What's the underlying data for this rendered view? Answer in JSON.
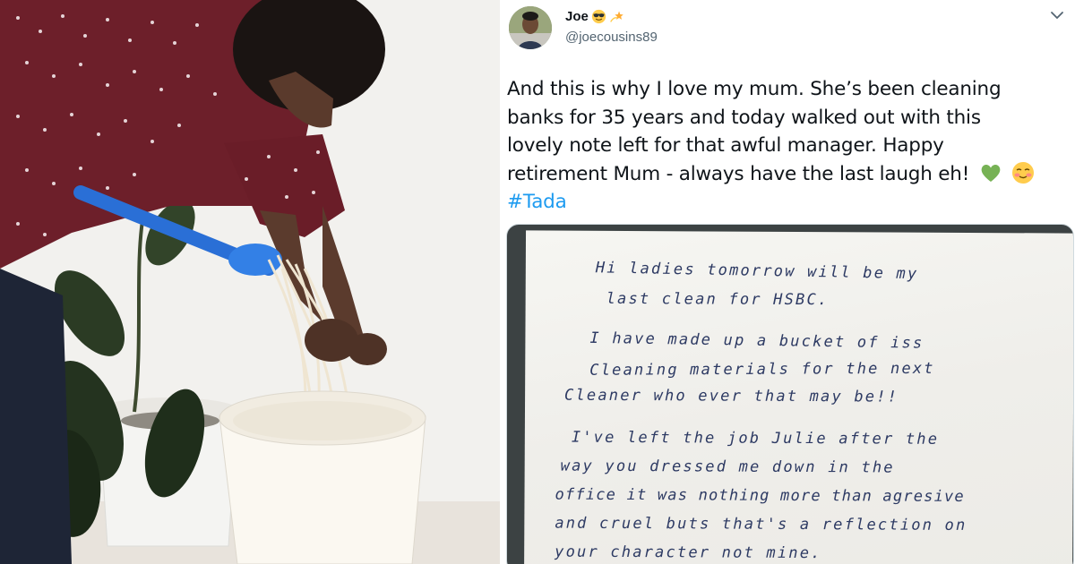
{
  "tweet": {
    "display_name": "Joe",
    "name_emojis": [
      "cool-face",
      "dizzy-star"
    ],
    "handle": "@joecousins89",
    "text_lines": [
      "And this is why I love my mum. She’s been cleaning",
      "banks for 35 years and today walked out with this",
      "lovely note left for that awful manager. Happy",
      "retirement Mum - always have the last laugh eh!"
    ],
    "trailing_emojis": [
      "green-heart",
      "blushing-face"
    ],
    "hashtag": "#Tada",
    "hashtag_color": "#1d9bf0"
  },
  "note": {
    "lines": [
      "Hi ladies tomorrow will be my",
      "last clean for HSBC.",
      "I have made up a bucket of iss",
      "Cleaning materials for the next",
      "Cleaner who ever that may be!!",
      "I've left the job Julie after the",
      "way you dressed me down in the",
      "office it was nothing more than agresive",
      "and cruel buts that's a reflection on",
      "your character not mine."
    ]
  }
}
